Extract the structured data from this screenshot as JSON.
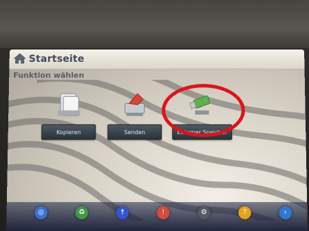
{
  "header": {
    "title": "Startseite"
  },
  "main": {
    "subtitle": "Funktion wählen",
    "tiles": [
      {
        "label": "Kopieren",
        "icon": "copy-icon"
      },
      {
        "label": "Senden",
        "icon": "send-icon"
      },
      {
        "label": "Externer Speicher",
        "icon": "usb-stick-icon"
      }
    ]
  },
  "dock": {
    "items": [
      {
        "icon": "globe-icon",
        "color": "#3b6fd6"
      },
      {
        "icon": "recycle-icon",
        "color": "#3e9a45"
      },
      {
        "icon": "accessibility-icon",
        "color": "#3257d0"
      },
      {
        "icon": "alert-icon",
        "color": "#d44c3c"
      },
      {
        "icon": "settings-icon",
        "color": "#565b63"
      },
      {
        "icon": "help-icon",
        "color": "#e5a21b"
      },
      {
        "icon": "forward-icon",
        "color": "#2f78d6"
      }
    ]
  },
  "colors": {
    "highlight": "#e0121a",
    "button_bg": "#3a424c",
    "title": "#3f4a56"
  }
}
